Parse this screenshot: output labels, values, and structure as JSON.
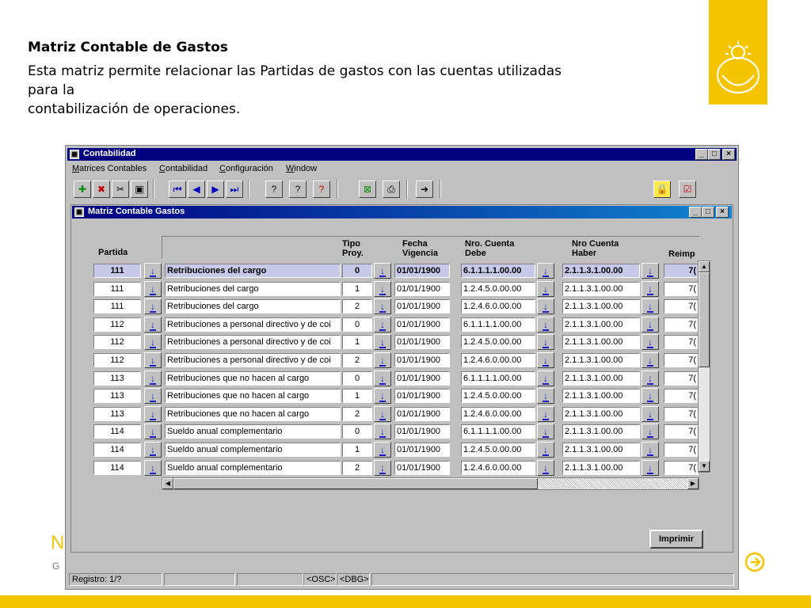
{
  "slide": {
    "title": "Matriz Contable de Gastos",
    "description_line1": "Esta matriz permite relacionar las Partidas de gastos con las cuentas utilizadas",
    "description_line2": "para la",
    "description_line3": "contabilización de operaciones.",
    "partial_n": "N",
    "partial_g": "G",
    "accent_color": "#f5c400"
  },
  "app": {
    "title": "Contabilidad",
    "menu": {
      "matrices": "atrices Contables",
      "matrices_key": "M",
      "contabilidad": "ontabilidad",
      "contabilidad_key": "C",
      "configuracion": "onfiguración",
      "configuracion_key": "C",
      "window": "indow",
      "window_key": "W"
    },
    "window_buttons": {
      "minimize": "_",
      "maximize": "□",
      "close": "×"
    }
  },
  "form": {
    "title": "Matriz Contable Gastos",
    "headers": {
      "partida": "Partida",
      "tipo_1": "Tipo",
      "tipo_2": "Proy.",
      "fecha_1": "Fecha",
      "fecha_2": "Vigencia",
      "debe_1": "Nro. Cuenta",
      "debe_2": "Debe",
      "haber_1": "Nro Cuenta",
      "haber_2": "Haber",
      "reimp": "Reimp"
    },
    "rows": [
      {
        "partida": "111",
        "descripcion": "Retribuciones del cargo",
        "tipo": "0",
        "fecha": "01/01/1900",
        "debe": "6.1.1.1.1.00.00",
        "haber": "2.1.1.3.1.00.00",
        "reimp": "7("
      },
      {
        "partida": "111",
        "descripcion": "Retribuciones del cargo",
        "tipo": "1",
        "fecha": "01/01/1900",
        "debe": "1.2.4.5.0.00.00",
        "haber": "2.1.1.3.1.00.00",
        "reimp": "7("
      },
      {
        "partida": "111",
        "descripcion": "Retribuciones del cargo",
        "tipo": "2",
        "fecha": "01/01/1900",
        "debe": "1.2.4.6.0.00.00",
        "haber": "2.1.1.3.1.00.00",
        "reimp": "7("
      },
      {
        "partida": "112",
        "descripcion": "Retribuciones a personal directivo y de coi",
        "tipo": "0",
        "fecha": "01/01/1900",
        "debe": "6.1.1.1.1.00.00",
        "haber": "2.1.1.3.1.00.00",
        "reimp": "7("
      },
      {
        "partida": "112",
        "descripcion": "Retribuciones a personal directivo y de coi",
        "tipo": "1",
        "fecha": "01/01/1900",
        "debe": "1.2.4.5.0.00.00",
        "haber": "2.1.1.3.1.00.00",
        "reimp": "7("
      },
      {
        "partida": "112",
        "descripcion": "Retribuciones a personal directivo y de coi",
        "tipo": "2",
        "fecha": "01/01/1900",
        "debe": "1.2.4.6.0.00.00",
        "haber": "2.1.1.3.1.00.00",
        "reimp": "7("
      },
      {
        "partida": "113",
        "descripcion": "Retribuciones que no hacen al cargo",
        "tipo": "0",
        "fecha": "01/01/1900",
        "debe": "6.1.1.1.1.00.00",
        "haber": "2.1.1.3.1.00.00",
        "reimp": "7("
      },
      {
        "partida": "113",
        "descripcion": "Retribuciones que no hacen al cargo",
        "tipo": "1",
        "fecha": "01/01/1900",
        "debe": "1.2.4.5.0.00.00",
        "haber": "2.1.1.3.1.00.00",
        "reimp": "7("
      },
      {
        "partida": "113",
        "descripcion": "Retribuciones que no hacen al cargo",
        "tipo": "2",
        "fecha": "01/01/1900",
        "debe": "1.2.4.6.0.00.00",
        "haber": "2.1.1.3.1.00.00",
        "reimp": "7("
      },
      {
        "partida": "114",
        "descripcion": "Sueldo anual complementario",
        "tipo": "0",
        "fecha": "01/01/1900",
        "debe": "6.1.1.1.1.00.00",
        "haber": "2.1.1.3.1.00.00",
        "reimp": "7("
      },
      {
        "partida": "114",
        "descripcion": "Sueldo anual complementario",
        "tipo": "1",
        "fecha": "01/01/1900",
        "debe": "1.2.4.5.0.00.00",
        "haber": "2.1.1.3.1.00.00",
        "reimp": "7("
      },
      {
        "partida": "114",
        "descripcion": "Sueldo anual complementario",
        "tipo": "2",
        "fecha": "01/01/1900",
        "debe": "1.2.4.6.0.00.00",
        "haber": "2.1.1.3.1.00.00",
        "reimp": "7("
      }
    ],
    "print_label": "Imprimir"
  },
  "status": {
    "registro": "Registro: 1/?",
    "osc": "<OSC>",
    "dbg": "<DBG>"
  }
}
